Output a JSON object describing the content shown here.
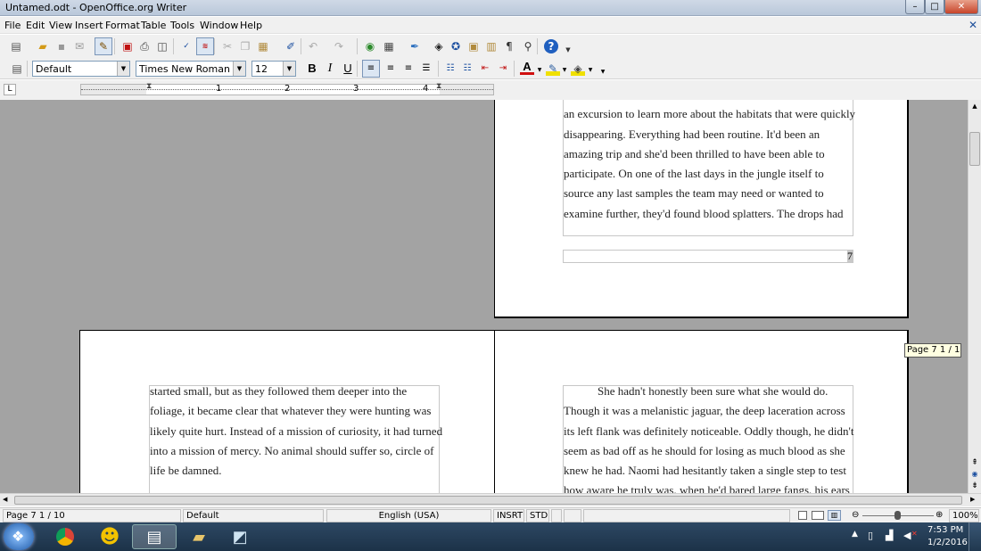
{
  "window": {
    "title": "Untamed.odt - OpenOffice.org Writer",
    "minimize_glyph": "–",
    "maximize_glyph": "□",
    "close_glyph": "✕"
  },
  "menubar": {
    "items": [
      "File",
      "Edit",
      "View",
      "Insert",
      "Format",
      "Table",
      "Tools",
      "Window",
      "Help"
    ],
    "close_doc_glyph": "✕"
  },
  "formatting": {
    "paragraph_style": "Default",
    "font_name": "Times New Roman",
    "font_size": "12",
    "bold": "B",
    "italic": "I",
    "underline": "U",
    "font_color_glyph": "A"
  },
  "ruler": {
    "corner_glyph": "L",
    "numbers": [
      "1",
      "2",
      "3",
      "4"
    ]
  },
  "document": {
    "top_right_lines": [
      "an excursion to learn more about the habitats that were quickly",
      "disappearing. Everything had been routine. It'd been an",
      "amazing trip and she'd been thrilled to have been able to",
      "participate. On one of the last days in the jungle itself to",
      "source any last samples the team may need or wanted to",
      "examine further, they'd found blood splatters. The drops had"
    ],
    "page_number_footer": "7",
    "bottom_left_lines": [
      "started small, but as they followed them deeper into the",
      "foliage, it became clear that whatever they were hunting was",
      "likely quite hurt. Instead of a mission of curiosity, it had turned",
      "into a mission of mercy. No animal should suffer so, circle of",
      "life be damned."
    ],
    "bottom_right_lines": [
      "She hadn't honestly been sure what she would do.",
      "Though it was a melanistic jaguar, the deep laceration across",
      "its left flank was definitely noticeable. Oddly though, he didn't",
      "seem as bad off as he should for losing as much blood as she",
      "knew he had. Naomi had hesitantly taken a single step to test",
      "how aware he truly was, when he'd bared large fangs, his ears"
    ],
    "page_tooltip": "Page 7  1 / 10"
  },
  "statusbar": {
    "page": "Page 7  1 / 10",
    "page_style": "Default",
    "language": "English (USA)",
    "insert_mode": "INSRT",
    "selection_mode": "STD",
    "zoom": "100%"
  },
  "taskbar": {
    "time": "7:53 PM",
    "date": "1/2/2016"
  }
}
